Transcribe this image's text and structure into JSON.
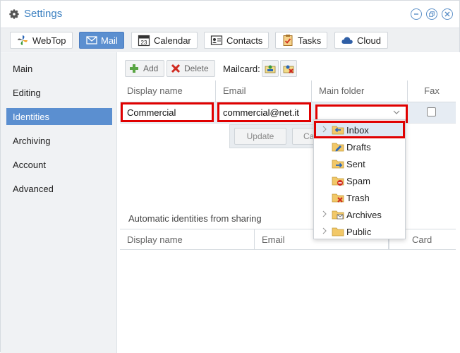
{
  "window": {
    "title": "Settings"
  },
  "toolbar": {
    "tabs": [
      {
        "label": "WebTop",
        "icon": "webtop-pinwheel-icon",
        "active": false
      },
      {
        "label": "Mail",
        "icon": "envelope-icon",
        "active": true
      },
      {
        "label": "Calendar",
        "icon": "calendar-icon",
        "calendar_day": "23",
        "active": false
      },
      {
        "label": "Contacts",
        "icon": "contact-card-icon",
        "active": false
      },
      {
        "label": "Tasks",
        "icon": "clipboard-check-icon",
        "active": false
      },
      {
        "label": "Cloud",
        "icon": "cloud-icon",
        "active": false
      }
    ]
  },
  "sidebar": {
    "items": [
      {
        "label": "Main",
        "selected": false
      },
      {
        "label": "Editing",
        "selected": false
      },
      {
        "label": "Identities",
        "selected": true
      },
      {
        "label": "Archiving",
        "selected": false
      },
      {
        "label": "Account",
        "selected": false
      },
      {
        "label": "Advanced",
        "selected": false
      }
    ]
  },
  "actions": {
    "add_label": "Add",
    "delete_label": "Delete",
    "mailcard_label": "Mailcard:"
  },
  "identities_grid": {
    "columns": [
      "Display name",
      "Email",
      "Main folder",
      "Fax"
    ],
    "editing_row": {
      "display_name": "Commercial",
      "email": "commercial@net.it",
      "main_folder": "",
      "fax": false
    }
  },
  "row_editor": {
    "update_label": "Update",
    "cancel_label_visible": "Ca"
  },
  "auto_identities": {
    "title": "Automatic identities from sharing",
    "columns": [
      "Display name",
      "Email",
      "Card"
    ]
  },
  "folder_dropdown": {
    "items": [
      {
        "label": "Inbox",
        "icon": "inbox-folder-icon",
        "expandable": true,
        "highlighted": true
      },
      {
        "label": "Drafts",
        "icon": "drafts-folder-icon",
        "expandable": false,
        "highlighted": false
      },
      {
        "label": "Sent",
        "icon": "sent-folder-icon",
        "expandable": false,
        "highlighted": false
      },
      {
        "label": "Spam",
        "icon": "spam-folder-icon",
        "expandable": false,
        "highlighted": false
      },
      {
        "label": "Trash",
        "icon": "trash-folder-icon",
        "expandable": false,
        "highlighted": false
      },
      {
        "label": "Archives",
        "icon": "archives-folder-icon",
        "expandable": true,
        "highlighted": false
      },
      {
        "label": "Public",
        "icon": "public-folder-icon",
        "expandable": true,
        "highlighted": false
      }
    ]
  },
  "colors": {
    "accent": "#5b8fd0",
    "title": "#3a7fc0",
    "highlight_border": "#e00000"
  }
}
